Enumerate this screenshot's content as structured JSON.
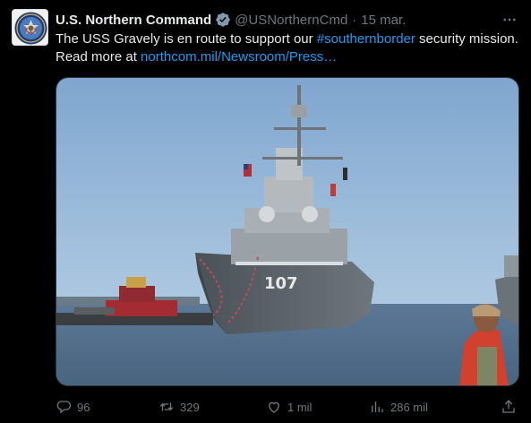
{
  "author": {
    "display_name": "U.S. Northern Command",
    "handle": "@USNorthernCmd",
    "separator": "·",
    "date": "15 mar."
  },
  "tweet": {
    "text_part1": "The USS Gravely is en route to support our ",
    "hashtag": "#southernborder",
    "text_part2": " security mission.",
    "text_part3": "Read more at ",
    "link": "northcom.mil/Newsroom/Press…"
  },
  "media": {
    "hull_number": "107"
  },
  "actions": {
    "replies": "96",
    "retweets": "329",
    "likes": "1 mil",
    "views": "286 mil"
  },
  "icons": {
    "avatar": "northcom-seal-icon",
    "verified": "verified-badge-icon",
    "more": "more-icon",
    "reply": "reply-icon",
    "retweet": "retweet-icon",
    "like": "heart-icon",
    "views": "views-icon",
    "share": "share-icon"
  },
  "colors": {
    "background": "#000000",
    "text": "#e7e9ea",
    "secondary_text": "#71767b",
    "link": "#1d9bf0"
  }
}
